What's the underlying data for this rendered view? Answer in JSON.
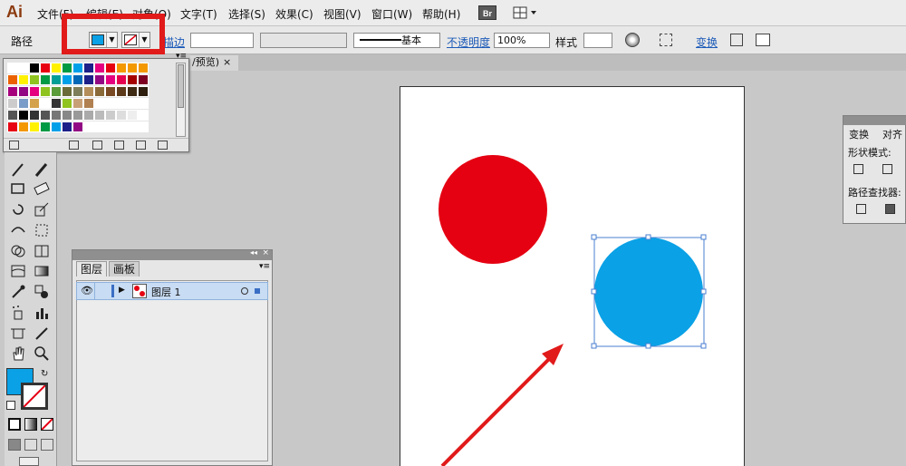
{
  "app": {
    "logo": "Ai"
  },
  "menu": [
    "文件(F)",
    "编辑(E)",
    "对象(O)",
    "文字(T)",
    "选择(S)",
    "效果(C)",
    "视图(V)",
    "窗口(W)",
    "帮助(H)"
  ],
  "bridge_label": "Br",
  "control_bar": {
    "mode_label": "路径",
    "fill_color": "#0aa1e6",
    "stroke_label": "描边",
    "stroke_weight": "",
    "brush_label": "基本",
    "opacity_label": "不透明度",
    "opacity_value": "100%",
    "style_label": "样式",
    "transform_label": "变换"
  },
  "doc_tab": {
    "title": "/预览)",
    "close": "×"
  },
  "swatches": {
    "rows": [
      [
        "#ffffff",
        "#ffffff",
        "#000000",
        "#e60012",
        "#fff100",
        "#009944",
        "#00a0e9",
        "#1d2088",
        "#e4007f",
        "#e60012",
        "#f39800",
        "#f39800",
        "#f39800"
      ],
      [
        "#eb6100",
        "#fff100",
        "#8fc31f",
        "#009944",
        "#009e96",
        "#00a0e9",
        "#0068b7",
        "#1d2088",
        "#920783",
        "#e4007f",
        "#e5004f",
        "#a40000",
        "#7d0022"
      ],
      [
        "#a6007d",
        "#920783",
        "#e4007f",
        "#8fc31f",
        "#5a9b3a",
        "#6b6b3a",
        "#7d7d5a",
        "#b48e5a",
        "#8b6a3a",
        "#7a4a24",
        "#5c3a1a",
        "#3f2a14",
        "#2e1f0f"
      ],
      [
        "#cccccc",
        "#7a9cc8",
        "#d4a24a",
        "#ffffff",
        "#333333",
        "#8fc31f",
        "#c8a078",
        "#b08050",
        "#ffffff",
        "#ffffff",
        "#ffffff",
        "#ffffff",
        "#ffffff"
      ],
      [
        "#555555",
        "#000000",
        "#333333",
        "#555555",
        "#777777",
        "#888888",
        "#999999",
        "#aaaaaa",
        "#bbbbbb",
        "#cccccc",
        "#dddddd",
        "#eeeeee",
        "#ffffff"
      ],
      [
        "#e60012",
        "#f39800",
        "#fff100",
        "#009944",
        "#00a0e9",
        "#1d2088",
        "#920783",
        "#ffffff",
        "#ffffff",
        "#ffffff",
        "#ffffff",
        "#ffffff",
        "#ffffff"
      ]
    ]
  },
  "layers_panel": {
    "tabs": [
      "图层",
      "画板"
    ],
    "layer_name": "图层 1"
  },
  "transform_panel": {
    "tabs": [
      "变换",
      "对齐"
    ],
    "shape_modes_label": "形状模式:",
    "pathfinder_label": "路径查找器:"
  },
  "colors": {
    "red_circle": "#e50012",
    "blue_circle": "#0aa1e6",
    "highlight": "#e11a1a",
    "annotation_arrow": "#e11a1a"
  }
}
